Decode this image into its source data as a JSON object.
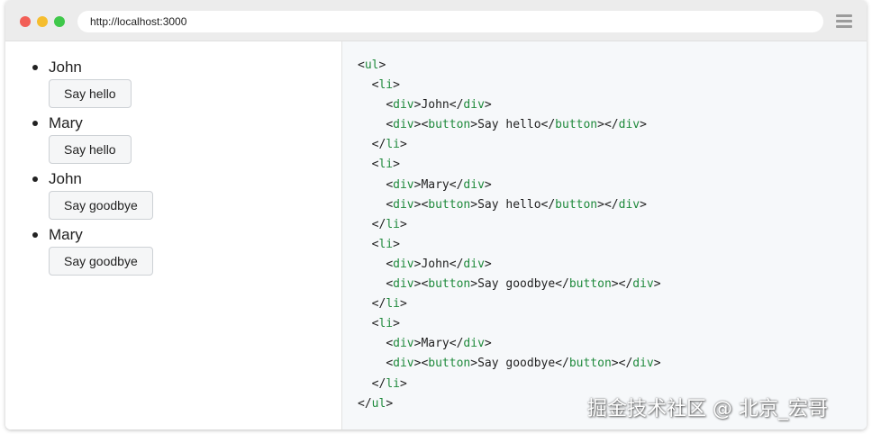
{
  "browser": {
    "url": "http://localhost:3000"
  },
  "rendered_list": [
    {
      "name": "John",
      "button_label": "Say hello"
    },
    {
      "name": "Mary",
      "button_label": "Say hello"
    },
    {
      "name": "John",
      "button_label": "Say goodbye"
    },
    {
      "name": "Mary",
      "button_label": "Say goodbye"
    }
  ],
  "code_view": {
    "lines": [
      {
        "indent": 0,
        "parts": [
          [
            "p",
            "<"
          ],
          [
            "t",
            "ul"
          ],
          [
            "p",
            ">"
          ]
        ]
      },
      {
        "indent": 1,
        "parts": [
          [
            "p",
            "<"
          ],
          [
            "t",
            "li"
          ],
          [
            "p",
            ">"
          ]
        ]
      },
      {
        "indent": 2,
        "parts": [
          [
            "p",
            "<"
          ],
          [
            "t",
            "div"
          ],
          [
            "p",
            ">John</"
          ],
          [
            "t",
            "div"
          ],
          [
            "p",
            ">"
          ]
        ]
      },
      {
        "indent": 2,
        "parts": [
          [
            "p",
            "<"
          ],
          [
            "t",
            "div"
          ],
          [
            "p",
            "><"
          ],
          [
            "t",
            "button"
          ],
          [
            "p",
            ">Say hello</"
          ],
          [
            "t",
            "button"
          ],
          [
            "p",
            "></"
          ],
          [
            "t",
            "div"
          ],
          [
            "p",
            ">"
          ]
        ]
      },
      {
        "indent": 1,
        "parts": [
          [
            "p",
            "</"
          ],
          [
            "t",
            "li"
          ],
          [
            "p",
            ">"
          ]
        ]
      },
      {
        "indent": 1,
        "parts": [
          [
            "p",
            "<"
          ],
          [
            "t",
            "li"
          ],
          [
            "p",
            ">"
          ]
        ]
      },
      {
        "indent": 2,
        "parts": [
          [
            "p",
            "<"
          ],
          [
            "t",
            "div"
          ],
          [
            "p",
            ">Mary</"
          ],
          [
            "t",
            "div"
          ],
          [
            "p",
            ">"
          ]
        ]
      },
      {
        "indent": 2,
        "parts": [
          [
            "p",
            "<"
          ],
          [
            "t",
            "div"
          ],
          [
            "p",
            "><"
          ],
          [
            "t",
            "button"
          ],
          [
            "p",
            ">Say hello</"
          ],
          [
            "t",
            "button"
          ],
          [
            "p",
            "></"
          ],
          [
            "t",
            "div"
          ],
          [
            "p",
            ">"
          ]
        ]
      },
      {
        "indent": 1,
        "parts": [
          [
            "p",
            "</"
          ],
          [
            "t",
            "li"
          ],
          [
            "p",
            ">"
          ]
        ]
      },
      {
        "indent": 1,
        "parts": [
          [
            "p",
            "<"
          ],
          [
            "t",
            "li"
          ],
          [
            "p",
            ">"
          ]
        ]
      },
      {
        "indent": 2,
        "parts": [
          [
            "p",
            "<"
          ],
          [
            "t",
            "div"
          ],
          [
            "p",
            ">John</"
          ],
          [
            "t",
            "div"
          ],
          [
            "p",
            ">"
          ]
        ]
      },
      {
        "indent": 2,
        "parts": [
          [
            "p",
            "<"
          ],
          [
            "t",
            "div"
          ],
          [
            "p",
            "><"
          ],
          [
            "t",
            "button"
          ],
          [
            "p",
            ">Say goodbye</"
          ],
          [
            "t",
            "button"
          ],
          [
            "p",
            "></"
          ],
          [
            "t",
            "div"
          ],
          [
            "p",
            ">"
          ]
        ]
      },
      {
        "indent": 1,
        "parts": [
          [
            "p",
            "</"
          ],
          [
            "t",
            "li"
          ],
          [
            "p",
            ">"
          ]
        ]
      },
      {
        "indent": 1,
        "parts": [
          [
            "p",
            "<"
          ],
          [
            "t",
            "li"
          ],
          [
            "p",
            ">"
          ]
        ]
      },
      {
        "indent": 2,
        "parts": [
          [
            "p",
            "<"
          ],
          [
            "t",
            "div"
          ],
          [
            "p",
            ">Mary</"
          ],
          [
            "t",
            "div"
          ],
          [
            "p",
            ">"
          ]
        ]
      },
      {
        "indent": 2,
        "parts": [
          [
            "p",
            "<"
          ],
          [
            "t",
            "div"
          ],
          [
            "p",
            "><"
          ],
          [
            "t",
            "button"
          ],
          [
            "p",
            ">Say goodbye</"
          ],
          [
            "t",
            "button"
          ],
          [
            "p",
            "></"
          ],
          [
            "t",
            "div"
          ],
          [
            "p",
            ">"
          ]
        ]
      },
      {
        "indent": 1,
        "parts": [
          [
            "p",
            "</"
          ],
          [
            "t",
            "li"
          ],
          [
            "p",
            ">"
          ]
        ]
      },
      {
        "indent": 0,
        "parts": [
          [
            "p",
            "</"
          ],
          [
            "t",
            "ul"
          ],
          [
            "p",
            ">"
          ]
        ]
      }
    ]
  },
  "watermark": "掘金技术社区 @ 北京_宏哥",
  "colors": {
    "tag": "#1f8a3c",
    "code_background": "#f6f8fa",
    "close_dot": "#f25f57",
    "minimize_dot": "#f5bd2e",
    "zoom_dot": "#3fc84a"
  },
  "icons": [
    "close-dot-icon",
    "minimize-dot-icon",
    "zoom-dot-icon",
    "hamburger-menu-icon",
    "bullet-icon"
  ]
}
